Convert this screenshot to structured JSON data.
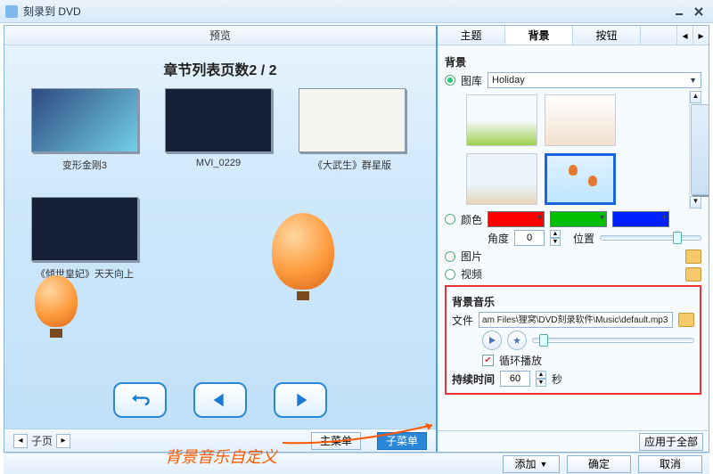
{
  "title": "刻录到 DVD",
  "preview": {
    "header": "预览",
    "page_title": "章节列表页数2 / 2",
    "items": [
      {
        "label": "变形金刚3"
      },
      {
        "label": "MVI_0229"
      },
      {
        "label": "《大武生》群星版"
      },
      {
        "label": "《倾世皇妃》天天向上"
      }
    ],
    "subpage": {
      "label": "子页",
      "value": ""
    },
    "menu_tabs": {
      "main": "主菜单",
      "sub": "子菜单",
      "active": "sub"
    }
  },
  "tabs": {
    "theme": "主题",
    "bg": "背景",
    "button": "按钮",
    "active": "bg"
  },
  "bg": {
    "section": "背景",
    "radio_lib": "图库",
    "lib_value": "Holiday",
    "radio_color": "颜色",
    "colors": [
      "#ff0000",
      "#00c000",
      "#0020ff"
    ],
    "angle_label": "角度",
    "angle_value": "0",
    "pos_label": "位置",
    "pos_pct": 72,
    "radio_image": "图片",
    "radio_video": "视频",
    "selected_radio": "lib"
  },
  "music": {
    "section": "背景音乐",
    "file_label": "文件",
    "file_value": "am Files\\狸窝\\DVD刻录软件\\Music\\default.mp3",
    "loop_label": "循环播放",
    "loop_checked": true,
    "dur_label": "持续时间",
    "dur_value": "60",
    "dur_unit": "秒",
    "slider_pct": 4
  },
  "apply_all": "应用于全部",
  "footer": {
    "add": "添加",
    "ok": "确定",
    "cancel": "取消"
  },
  "annotation": "背景音乐自定义"
}
